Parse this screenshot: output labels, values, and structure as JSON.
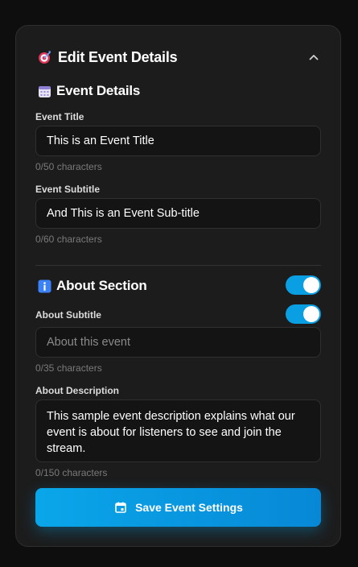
{
  "header": {
    "title": "Edit Event Details",
    "icon": "target-icon"
  },
  "event_details": {
    "title": "Event Details",
    "icon": "calendar-icon",
    "event_title": {
      "label": "Event Title",
      "value": "This is an Event Title",
      "counter": "0/50 characters"
    },
    "event_subtitle": {
      "label": "Event Subtitle",
      "value": "And This is an Event Sub-title",
      "counter": "0/60 characters"
    }
  },
  "about_section": {
    "title": "About Section",
    "icon": "info-icon",
    "enabled": true,
    "about_subtitle": {
      "label": "About Subtitle",
      "enabled": true,
      "placeholder": "About this event",
      "counter": "0/35 characters"
    },
    "about_description": {
      "label": "About Description",
      "value": "This sample event description explains what our event is about for listeners to see and join the stream.",
      "counter": "0/150 characters"
    }
  },
  "save_button": {
    "label": "Save Event Settings",
    "icon": "calendar-icon"
  },
  "colors": {
    "accent": "#0a9fe3",
    "panel": "#1c1c1c",
    "field": "#141414"
  }
}
